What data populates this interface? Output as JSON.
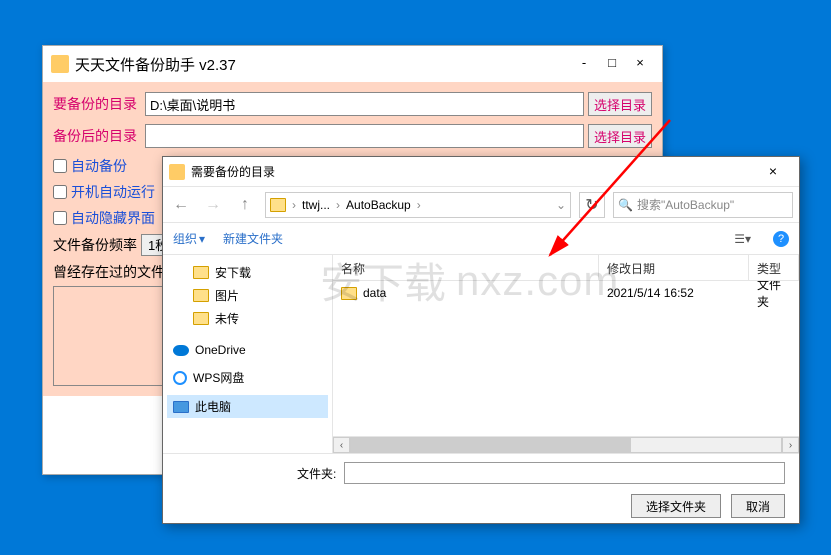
{
  "main": {
    "title": "天天文件备份助手 v2.37",
    "source_label": "要备份的目录",
    "source_value": "D:\\桌面\\说明书",
    "dest_label": "备份后的目录",
    "dest_value": "",
    "choose_btn": "选择目录",
    "auto_backup": "自动备份",
    "auto_run": "开机自动运行",
    "auto_hide": "自动隐藏界面",
    "freq_label": "文件备份频率",
    "freq_value": "1秒",
    "history_label": "曾经存在过的文件"
  },
  "dialog": {
    "title": "需要备份的目录",
    "breadcrumb": {
      "p1": "ttwj...",
      "p2": "AutoBackup"
    },
    "search_placeholder": "搜索\"AutoBackup\"",
    "organize": "组织",
    "new_folder": "新建文件夹",
    "tree": {
      "anxiazai": "安下载",
      "pictures": "图片",
      "weichuan": "未传",
      "onedrive": "OneDrive",
      "wps": "WPS网盘",
      "thispc": "此电脑"
    },
    "cols": {
      "name": "名称",
      "date": "修改日期",
      "type": "类型"
    },
    "files": [
      {
        "name": "data",
        "date": "2021/5/14 16:52",
        "type": "文件夹"
      }
    ],
    "folder_label": "文件夹:",
    "select_btn": "选择文件夹",
    "cancel_btn": "取消"
  },
  "watermark": "nxz.com"
}
